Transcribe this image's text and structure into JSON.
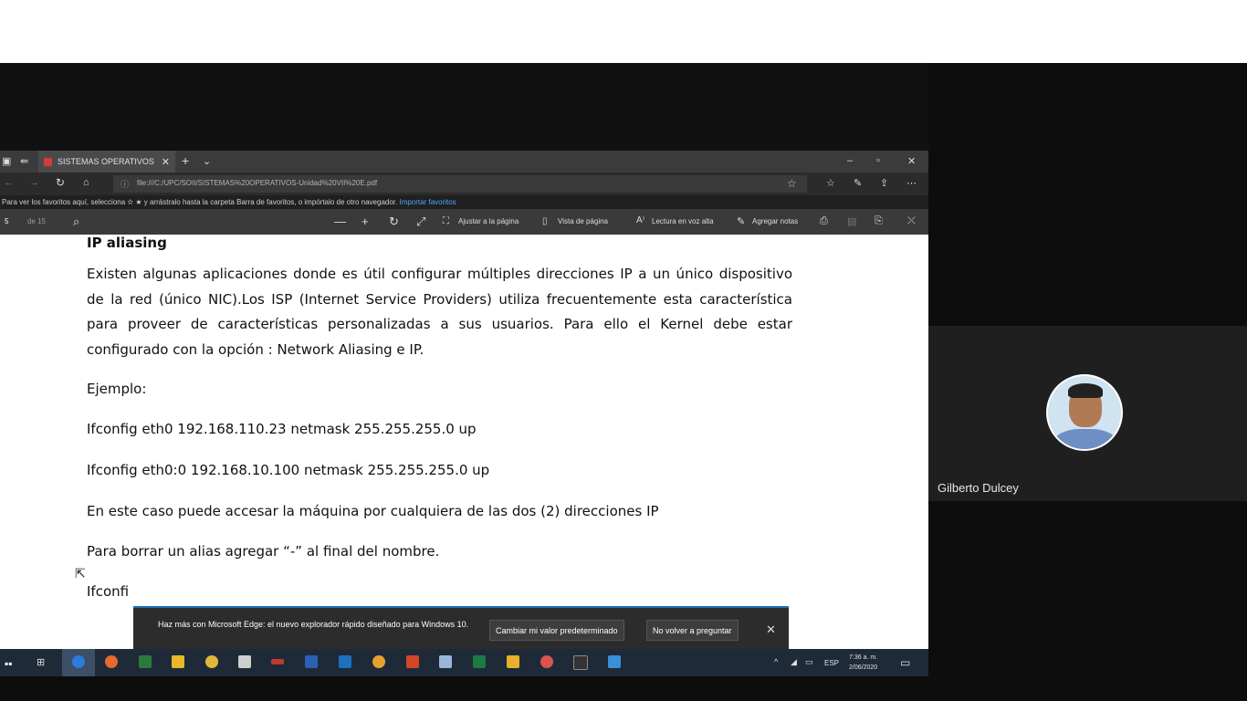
{
  "browser": {
    "tab_title": "SISTEMAS OPERATIVOS",
    "url": "file:///C:/UPC/SOII/SISTEMAS%20OPERATIVOS-Unidad%20VII%20E.pdf",
    "favorites_message": "Para ver los favoritos aquí, selecciona",
    "favorites_message_2": "y arrástralo hasta la carpeta Barra de favoritos, o impórtalo de otro navegador.",
    "favorites_link": "Importar favoritos"
  },
  "pdf_toolbar": {
    "page_current": "5",
    "page_total": "de 15",
    "fit_page": "Ajustar a la página",
    "page_view": "Vista de página",
    "read_aloud": "Lectura en voz alta",
    "add_notes": "Agregar notas"
  },
  "document": {
    "heading": "IP aliasing",
    "para1": "Existen algunas aplicaciones donde es útil configurar múltiples direcciones IP a un único dispositivo de la red (único NIC).Los ISP (Internet Service Providers) utiliza frecuentemente esta característica para proveer de características personalizadas  a sus usuarios. Para ello el Kernel debe estar configurado con la opción : Network Aliasing e IP.",
    "example_label": "Ejemplo:",
    "cmd1": "Ifconfig  eth0 192.168.110.23 netmask 255.255.255.0 up",
    "cmd2": "Ifconfig eth0:0 192.168.10.100 netmask 255.255.255.0 up",
    "para2": "En este caso puede accesar la máquina por cualquiera de las dos (2) direcciones IP",
    "para3": "Para borrar un alias agregar  “-”   al final del nombre.",
    "cmd3_partial": "Ifconfi"
  },
  "notification": {
    "text": "Haz más con Microsoft Edge: el nuevo explorador rápido diseñado para Windows 10.",
    "btn_default": "Cambiar mi valor predeterminado",
    "btn_never": "No volver a preguntar"
  },
  "taskbar": {
    "language": "ESP",
    "time": "7:36 a. m.",
    "date": "2/06/2020"
  },
  "participant": {
    "name": "Gilberto Dulcey"
  }
}
